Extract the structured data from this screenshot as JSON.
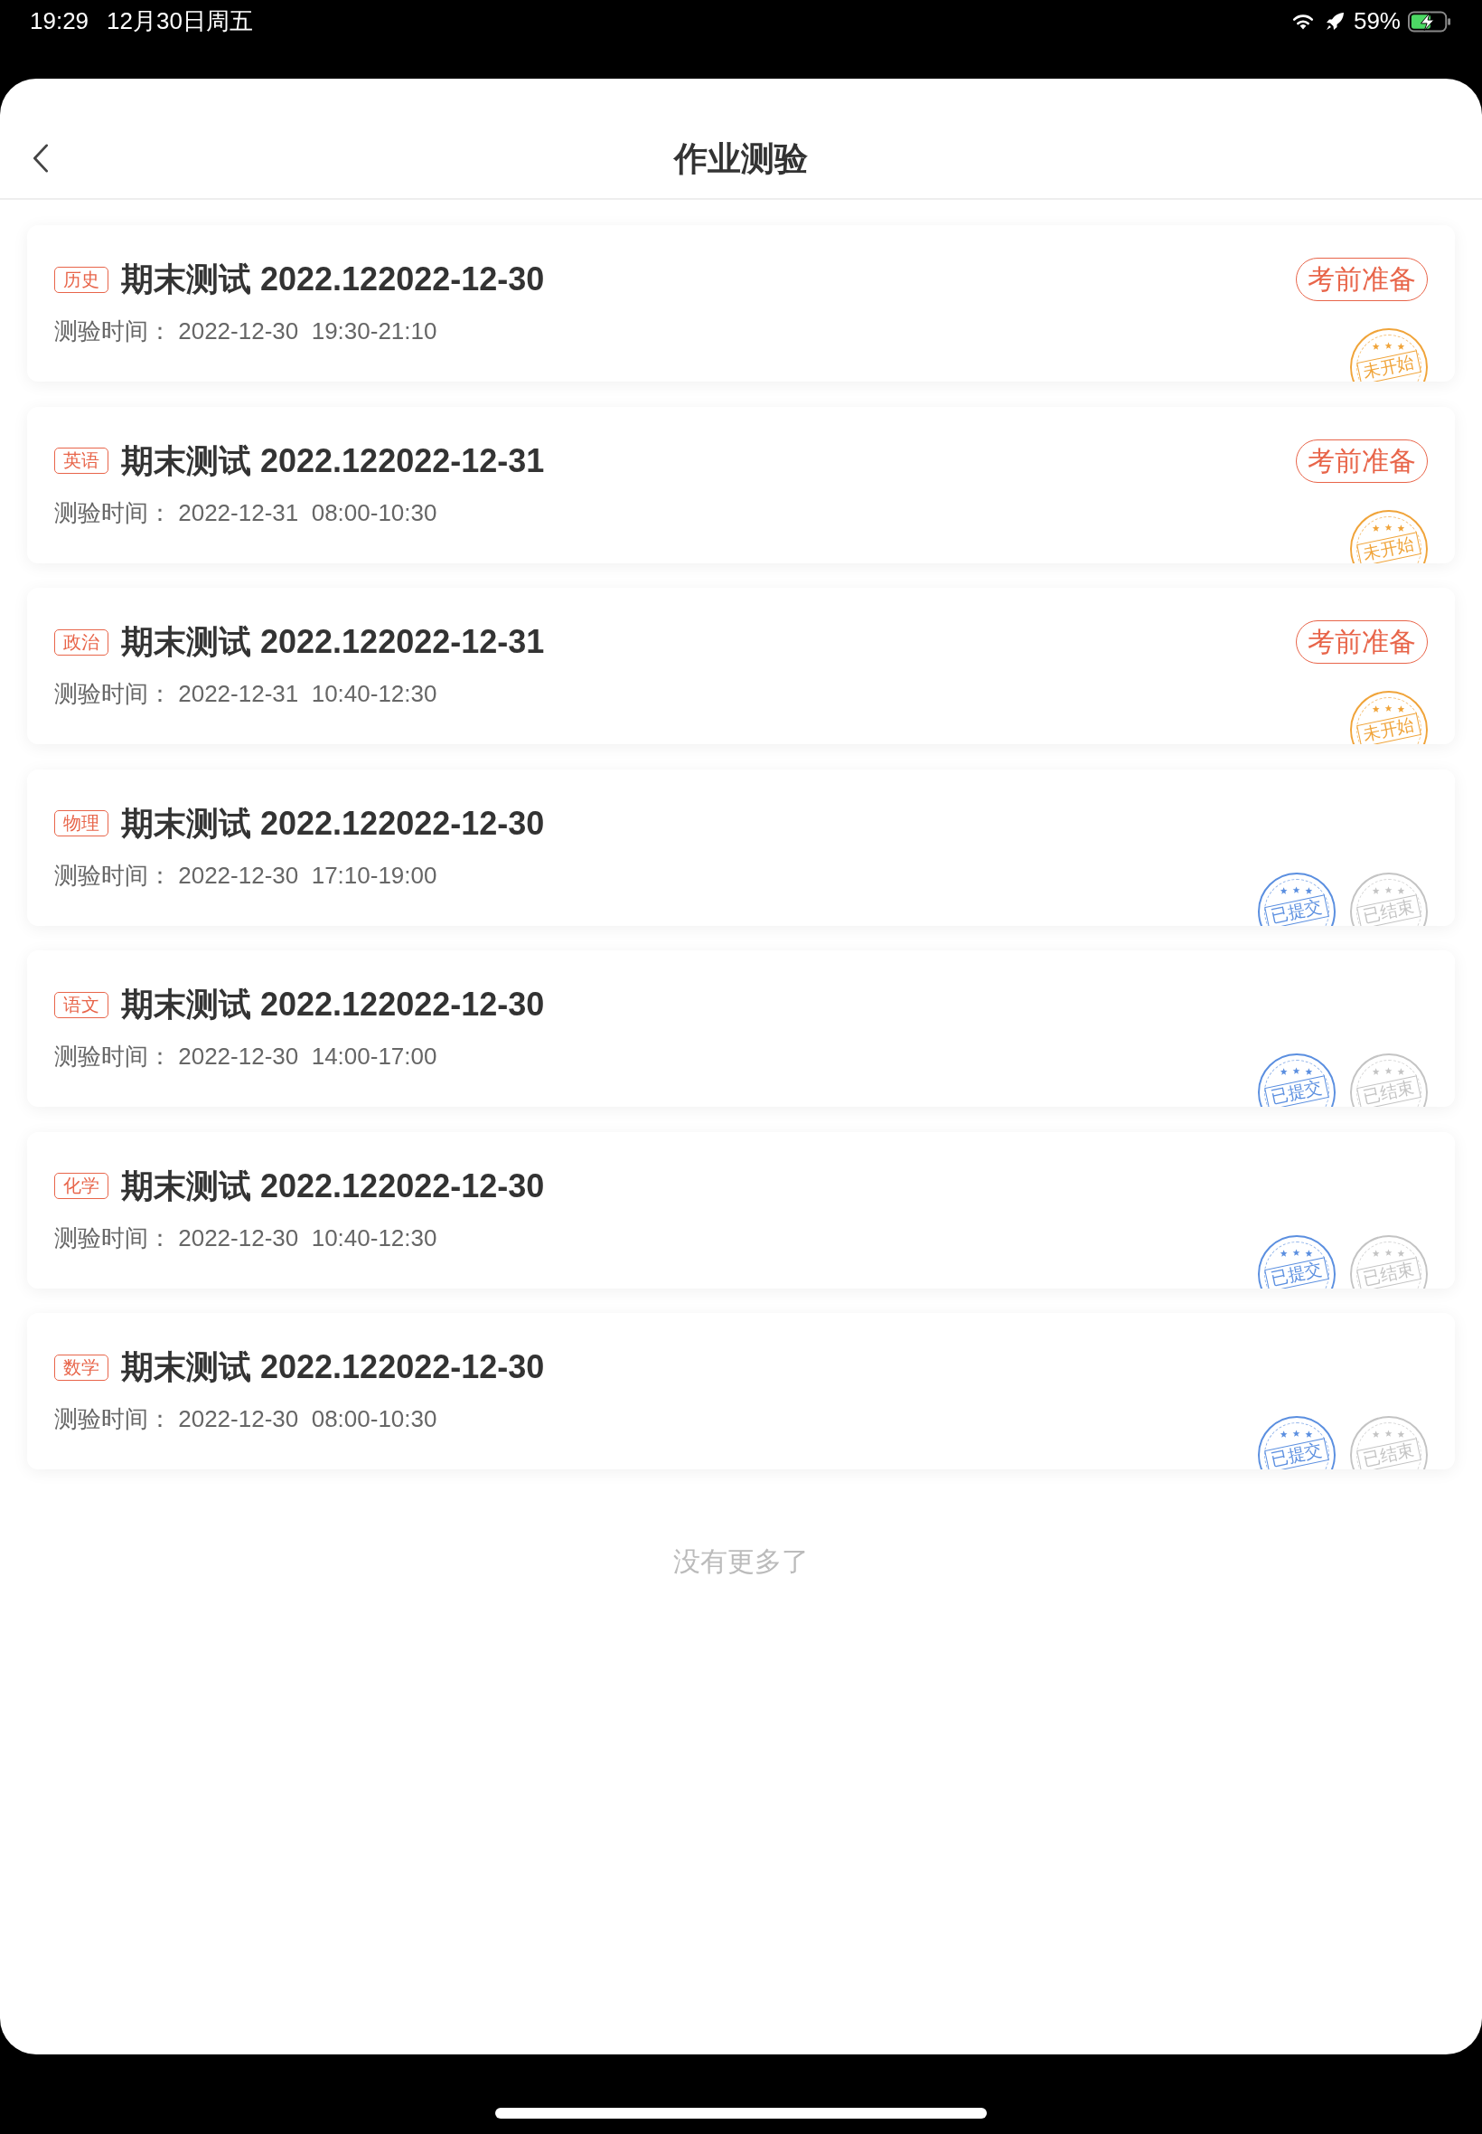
{
  "status_bar": {
    "time": "19:29",
    "date": "12月30日周五",
    "battery": "59%"
  },
  "header": {
    "title": "作业测验"
  },
  "exams": [
    {
      "subject": "历史",
      "title": "期末测试 2022.122022-12-30",
      "meta": "测验时间： 2022-12-30  19:30-21:10",
      "action": "考前准备",
      "stamps": [
        {
          "label": "未开始",
          "color": "#f0a43a"
        }
      ]
    },
    {
      "subject": "英语",
      "title": "期末测试 2022.122022-12-31",
      "meta": "测验时间： 2022-12-31  08:00-10:30",
      "action": "考前准备",
      "stamps": [
        {
          "label": "未开始",
          "color": "#f0a43a"
        }
      ]
    },
    {
      "subject": "政治",
      "title": "期末测试 2022.122022-12-31",
      "meta": "测验时间： 2022-12-31  10:40-12:30",
      "action": "考前准备",
      "stamps": [
        {
          "label": "未开始",
          "color": "#f0a43a"
        }
      ]
    },
    {
      "subject": "物理",
      "title": "期末测试 2022.122022-12-30",
      "meta": "测验时间： 2022-12-30  17:10-19:00",
      "stamps": [
        {
          "label": "已提交",
          "color": "#5b8fe0"
        },
        {
          "label": "已结束",
          "color": "#c4c4c4"
        }
      ]
    },
    {
      "subject": "语文",
      "title": "期末测试 2022.122022-12-30",
      "meta": "测验时间： 2022-12-30  14:00-17:00",
      "stamps": [
        {
          "label": "已提交",
          "color": "#5b8fe0"
        },
        {
          "label": "已结束",
          "color": "#c4c4c4"
        }
      ]
    },
    {
      "subject": "化学",
      "title": "期末测试 2022.122022-12-30",
      "meta": "测验时间： 2022-12-30  10:40-12:30",
      "stamps": [
        {
          "label": "已提交",
          "color": "#5b8fe0"
        },
        {
          "label": "已结束",
          "color": "#c4c4c4"
        }
      ]
    },
    {
      "subject": "数学",
      "title": "期末测试 2022.122022-12-30",
      "meta": "测验时间： 2022-12-30  08:00-10:30",
      "stamps": [
        {
          "label": "已提交",
          "color": "#5b8fe0"
        },
        {
          "label": "已结束",
          "color": "#c4c4c4"
        }
      ]
    }
  ],
  "footer": "没有更多了"
}
